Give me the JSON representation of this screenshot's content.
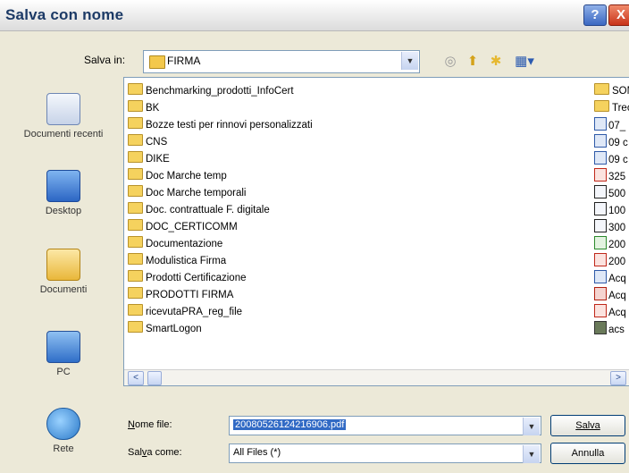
{
  "window": {
    "title": "Salva con nome",
    "help_label": "?",
    "close_label": "X"
  },
  "savein": {
    "label": "Salva in:",
    "folder": "FIRMA",
    "toolbar_icons": [
      "back-icon",
      "up-folder-icon",
      "new-folder-icon",
      "view-menu-icon"
    ]
  },
  "places": [
    {
      "name": "recent",
      "label": "Documenti recenti"
    },
    {
      "name": "desktop",
      "label": "Desktop"
    },
    {
      "name": "documents",
      "label": "Documenti"
    },
    {
      "name": "pc",
      "label": "PC"
    },
    {
      "name": "network",
      "label": "Rete"
    }
  ],
  "folders": [
    "Benchmarking_prodotti_InfoCert",
    "BK",
    "Bozze testi per rinnovi personalizzati",
    "CNS",
    "DIKE",
    "Doc Marche temp",
    "Doc Marche temporali",
    "Doc. contrattuale F. digitale",
    "DOC_CERTICOMM",
    "Documentazione",
    "Modulistica Firma",
    "Prodotti Certificazione",
    "PRODOTTI FIRMA",
    "ricevutaPRA_reg_file",
    "SmartLogon"
  ],
  "files_col2": [
    {
      "text": "SOM",
      "icon": "folder"
    },
    {
      "text": "Trec",
      "icon": "folder"
    },
    {
      "text": "07_",
      "icon": "word"
    },
    {
      "text": "09 c",
      "icon": "word"
    },
    {
      "text": "09 c",
      "icon": "word"
    },
    {
      "text": "325",
      "icon": "pdf"
    },
    {
      "text": "500",
      "icon": "plain"
    },
    {
      "text": "100",
      "icon": "plain"
    },
    {
      "text": "300",
      "icon": "plain"
    },
    {
      "text": "200",
      "icon": "xls"
    },
    {
      "text": "200",
      "icon": "pdf"
    },
    {
      "text": "Acq",
      "icon": "word"
    },
    {
      "text": "Acq",
      "icon": "red"
    },
    {
      "text": "Acq",
      "icon": "pdf"
    },
    {
      "text": "acs",
      "icon": "stack"
    }
  ],
  "scroll": {
    "left": "<",
    "right": ">"
  },
  "filename": {
    "label_u": "N",
    "label_rest": "ome file:",
    "value": "20080526124216906.pdf"
  },
  "filetype": {
    "label_pre": "Sal",
    "label_u": "v",
    "label_rest": "a come:",
    "value": "All Files (*)"
  },
  "buttons": {
    "save": "Salva",
    "cancel": "Annulla"
  },
  "colors": {
    "title": "#1c3a66",
    "close": "#c8331a",
    "help": "#3a67c2",
    "folder": "#f5d25e"
  }
}
